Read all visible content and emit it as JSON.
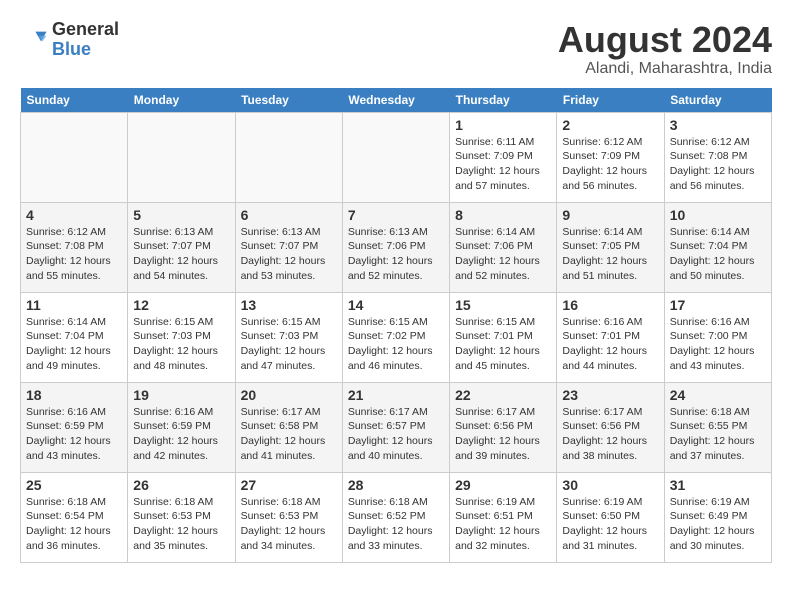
{
  "header": {
    "logo_general": "General",
    "logo_blue": "Blue",
    "month_year": "August 2024",
    "location": "Alandi, Maharashtra, India"
  },
  "days_of_week": [
    "Sunday",
    "Monday",
    "Tuesday",
    "Wednesday",
    "Thursday",
    "Friday",
    "Saturday"
  ],
  "weeks": [
    [
      {
        "day": "",
        "info": ""
      },
      {
        "day": "",
        "info": ""
      },
      {
        "day": "",
        "info": ""
      },
      {
        "day": "",
        "info": ""
      },
      {
        "day": "1",
        "info": "Sunrise: 6:11 AM\nSunset: 7:09 PM\nDaylight: 12 hours\nand 57 minutes."
      },
      {
        "day": "2",
        "info": "Sunrise: 6:12 AM\nSunset: 7:09 PM\nDaylight: 12 hours\nand 56 minutes."
      },
      {
        "day": "3",
        "info": "Sunrise: 6:12 AM\nSunset: 7:08 PM\nDaylight: 12 hours\nand 56 minutes."
      }
    ],
    [
      {
        "day": "4",
        "info": "Sunrise: 6:12 AM\nSunset: 7:08 PM\nDaylight: 12 hours\nand 55 minutes."
      },
      {
        "day": "5",
        "info": "Sunrise: 6:13 AM\nSunset: 7:07 PM\nDaylight: 12 hours\nand 54 minutes."
      },
      {
        "day": "6",
        "info": "Sunrise: 6:13 AM\nSunset: 7:07 PM\nDaylight: 12 hours\nand 53 minutes."
      },
      {
        "day": "7",
        "info": "Sunrise: 6:13 AM\nSunset: 7:06 PM\nDaylight: 12 hours\nand 52 minutes."
      },
      {
        "day": "8",
        "info": "Sunrise: 6:14 AM\nSunset: 7:06 PM\nDaylight: 12 hours\nand 52 minutes."
      },
      {
        "day": "9",
        "info": "Sunrise: 6:14 AM\nSunset: 7:05 PM\nDaylight: 12 hours\nand 51 minutes."
      },
      {
        "day": "10",
        "info": "Sunrise: 6:14 AM\nSunset: 7:04 PM\nDaylight: 12 hours\nand 50 minutes."
      }
    ],
    [
      {
        "day": "11",
        "info": "Sunrise: 6:14 AM\nSunset: 7:04 PM\nDaylight: 12 hours\nand 49 minutes."
      },
      {
        "day": "12",
        "info": "Sunrise: 6:15 AM\nSunset: 7:03 PM\nDaylight: 12 hours\nand 48 minutes."
      },
      {
        "day": "13",
        "info": "Sunrise: 6:15 AM\nSunset: 7:03 PM\nDaylight: 12 hours\nand 47 minutes."
      },
      {
        "day": "14",
        "info": "Sunrise: 6:15 AM\nSunset: 7:02 PM\nDaylight: 12 hours\nand 46 minutes."
      },
      {
        "day": "15",
        "info": "Sunrise: 6:15 AM\nSunset: 7:01 PM\nDaylight: 12 hours\nand 45 minutes."
      },
      {
        "day": "16",
        "info": "Sunrise: 6:16 AM\nSunset: 7:01 PM\nDaylight: 12 hours\nand 44 minutes."
      },
      {
        "day": "17",
        "info": "Sunrise: 6:16 AM\nSunset: 7:00 PM\nDaylight: 12 hours\nand 43 minutes."
      }
    ],
    [
      {
        "day": "18",
        "info": "Sunrise: 6:16 AM\nSunset: 6:59 PM\nDaylight: 12 hours\nand 43 minutes."
      },
      {
        "day": "19",
        "info": "Sunrise: 6:16 AM\nSunset: 6:59 PM\nDaylight: 12 hours\nand 42 minutes."
      },
      {
        "day": "20",
        "info": "Sunrise: 6:17 AM\nSunset: 6:58 PM\nDaylight: 12 hours\nand 41 minutes."
      },
      {
        "day": "21",
        "info": "Sunrise: 6:17 AM\nSunset: 6:57 PM\nDaylight: 12 hours\nand 40 minutes."
      },
      {
        "day": "22",
        "info": "Sunrise: 6:17 AM\nSunset: 6:56 PM\nDaylight: 12 hours\nand 39 minutes."
      },
      {
        "day": "23",
        "info": "Sunrise: 6:17 AM\nSunset: 6:56 PM\nDaylight: 12 hours\nand 38 minutes."
      },
      {
        "day": "24",
        "info": "Sunrise: 6:18 AM\nSunset: 6:55 PM\nDaylight: 12 hours\nand 37 minutes."
      }
    ],
    [
      {
        "day": "25",
        "info": "Sunrise: 6:18 AM\nSunset: 6:54 PM\nDaylight: 12 hours\nand 36 minutes."
      },
      {
        "day": "26",
        "info": "Sunrise: 6:18 AM\nSunset: 6:53 PM\nDaylight: 12 hours\nand 35 minutes."
      },
      {
        "day": "27",
        "info": "Sunrise: 6:18 AM\nSunset: 6:53 PM\nDaylight: 12 hours\nand 34 minutes."
      },
      {
        "day": "28",
        "info": "Sunrise: 6:18 AM\nSunset: 6:52 PM\nDaylight: 12 hours\nand 33 minutes."
      },
      {
        "day": "29",
        "info": "Sunrise: 6:19 AM\nSunset: 6:51 PM\nDaylight: 12 hours\nand 32 minutes."
      },
      {
        "day": "30",
        "info": "Sunrise: 6:19 AM\nSunset: 6:50 PM\nDaylight: 12 hours\nand 31 minutes."
      },
      {
        "day": "31",
        "info": "Sunrise: 6:19 AM\nSunset: 6:49 PM\nDaylight: 12 hours\nand 30 minutes."
      }
    ]
  ]
}
